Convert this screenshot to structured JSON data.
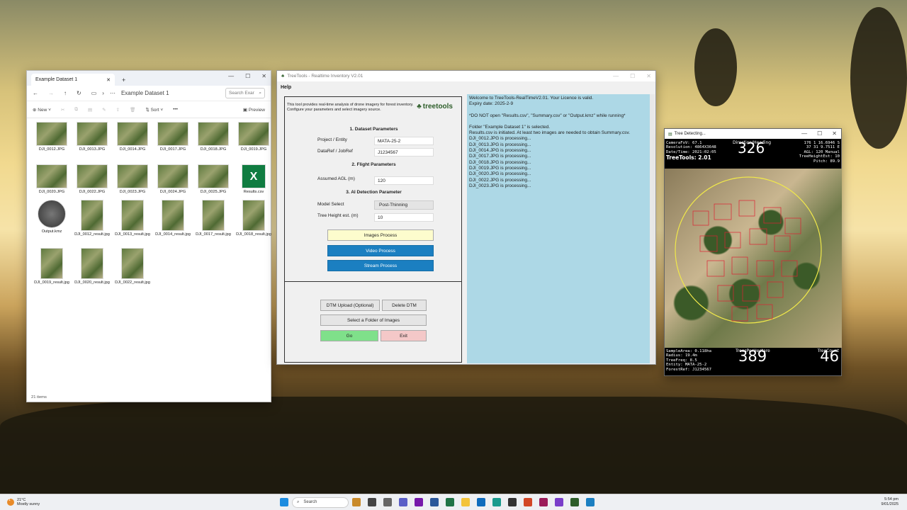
{
  "explorer": {
    "tab_title": "Example Dataset 1",
    "path": "Example Dataset 1",
    "search_placeholder": "Search Exar",
    "cmd": {
      "new": "New",
      "sort": "Sort",
      "more": "•••",
      "preview": "Preview"
    },
    "files": [
      {
        "name": "DJI_0012.JPG"
      },
      {
        "name": "DJI_0013.JPG"
      },
      {
        "name": "DJI_0014.JPG"
      },
      {
        "name": "DJI_0017.JPG"
      },
      {
        "name": "DJI_0018.JPG"
      },
      {
        "name": "DJI_0019.JPG"
      },
      {
        "name": "DJI_0020.JPG"
      },
      {
        "name": "DJI_0022.JPG"
      },
      {
        "name": "DJI_0023.JPG"
      },
      {
        "name": "DJI_0024.JPG"
      },
      {
        "name": "DJI_0025.JPG"
      },
      {
        "name": "Results.csv"
      },
      {
        "name": "Output.kmz"
      },
      {
        "name": "DJI_0012_result.jpg"
      },
      {
        "name": "DJI_0013_result.jpg"
      },
      {
        "name": "DJI_0014_result.jpg"
      },
      {
        "name": "DJI_0017_result.jpg"
      },
      {
        "name": "DJI_0018_result.jpg"
      },
      {
        "name": "DJI_0019_result.jpg"
      },
      {
        "name": "DJI_0020_result.jpg"
      },
      {
        "name": "DJI_0022_result.jpg"
      }
    ],
    "status": "21 items"
  },
  "treetools": {
    "title": "TreeTools - Realtime Inventory V2.01",
    "menu_help": "Help",
    "intro": "This tool provides real-time analysis of drone imagery for forest inventory. Configure your parameters and select imagery source.",
    "logo": "treetools",
    "sec1": "1. Dataset Parameters",
    "project_label": "Project / Entity",
    "project_value": "MATA-25-2",
    "dataref_label": "DataRef / JobRef",
    "dataref_value": "J1234567",
    "sec2": "2. Flight Parameters",
    "agl_label": "Assumed AGL (m)",
    "agl_value": "120",
    "sec3": "3. AI Detection Parameter",
    "model_label": "Model Select",
    "model_value": "Post-Thinning",
    "height_label": "Tree Height est. (m)",
    "height_value": "10",
    "btn_images": "Images Process",
    "btn_video": "Video Process",
    "btn_stream": "Stream Process",
    "btn_dtm": "DTM Upload (Optional)",
    "btn_delete_dtm": "Delete DTM",
    "btn_folder": "Select a Folder of Images",
    "btn_go": "Go",
    "btn_exit": "Exit",
    "log": [
      "Welcome to TreeTools-RealTimeV2.01. Your Licence is valid.",
      "Expiry date: 2025-2-9",
      "",
      "*DO NOT open \"Results.csv\", \"Summary.csv\" or \"Output.kmz\" while running*",
      "",
      "Folder \"Example Dataset 1\" is selected.",
      "Results.csv is initiated. At least two images are needed to obtain Summary.csv.",
      "DJI_0012.JPG is processing...",
      "DJI_0013.JPG is processing...",
      "DJI_0014.JPG is processing...",
      "DJI_0017.JPG is processing...",
      "DJI_0018.JPG is processing...",
      "DJI_0019.JPG is processing...",
      "DJI_0020.JPG is processing...",
      "DJI_0022.JPG is processing...",
      "DJI_0023.JPG is processing..."
    ]
  },
  "detect": {
    "title": "Tree Detecting...",
    "camera": "CameraFoV: 67.1",
    "resolution": "Resolution: 4864X3648",
    "datetime": "Date/Time: 2021:02:05",
    "brand": "TreeTools: 2.01",
    "dir_label": "Direction/Heading",
    "dir_value": "326",
    "coord1": "176 1 16.6946 S",
    "coord2": "37 31 9.7511 E",
    "agl": "AGL: 120 Manual",
    "theight": "TreeHeightEst: 10",
    "pitch": "Pitch: 89.9",
    "sample": "SampleArea: 0.118ha",
    "radius": "Radius: 19.4m",
    "freq": "TreeFreq: 8.5",
    "entity": "Entity: MATA-25-2",
    "forestref": "ForestRef: J1234567",
    "tph_label": "TreesPerHectare",
    "tph_value": "389",
    "count_label": "TreeCount",
    "count_value": "46"
  },
  "taskbar": {
    "temp": "21°C",
    "weather": "Mostly sunny",
    "search": "Search",
    "time": "5:54 pm",
    "date": "9/01/2025",
    "badge": "1"
  }
}
